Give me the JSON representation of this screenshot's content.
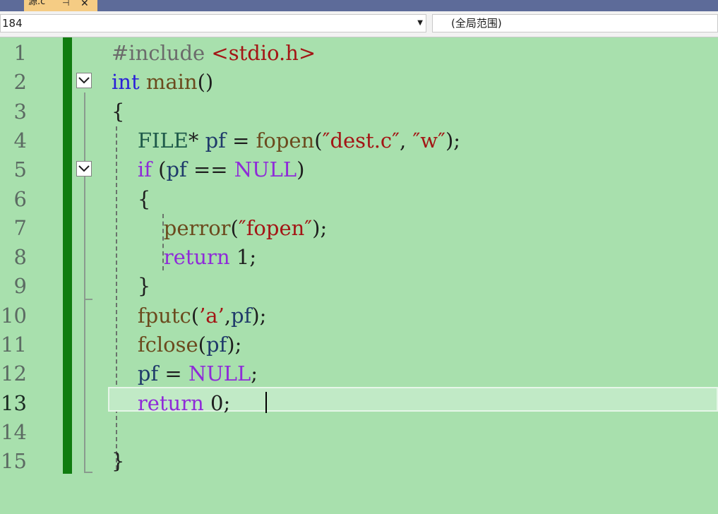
{
  "tab": {
    "title": "源.c",
    "pin_icon": "pin-icon",
    "close_icon": "close-icon"
  },
  "navbar": {
    "project": "184",
    "scope": "(全局范围)"
  },
  "editor": {
    "current_line": 13,
    "lines": [
      {
        "n": "1"
      },
      {
        "n": "2"
      },
      {
        "n": "3"
      },
      {
        "n": "4"
      },
      {
        "n": "5"
      },
      {
        "n": "6"
      },
      {
        "n": "7"
      },
      {
        "n": "8"
      },
      {
        "n": "9"
      },
      {
        "n": "10"
      },
      {
        "n": "11"
      },
      {
        "n": "12"
      },
      {
        "n": "13"
      },
      {
        "n": "14"
      },
      {
        "n": "15"
      }
    ],
    "code": [
      [
        {
          "t": "#include ",
          "c": "pp"
        },
        {
          "t": "<stdio.h>",
          "c": "str"
        }
      ],
      [
        {
          "t": "int",
          "c": "kw"
        },
        {
          "t": " ",
          "c": "op"
        },
        {
          "t": "main",
          "c": "fn"
        },
        {
          "t": "()",
          "c": "op"
        }
      ],
      [
        {
          "t": "{",
          "c": "op"
        }
      ],
      [
        {
          "t": "    ",
          "c": "op"
        },
        {
          "t": "FILE",
          "c": "type"
        },
        {
          "t": "* ",
          "c": "op"
        },
        {
          "t": "pf",
          "c": "id"
        },
        {
          "t": " = ",
          "c": "op"
        },
        {
          "t": "fopen",
          "c": "fn"
        },
        {
          "t": "(",
          "c": "op"
        },
        {
          "t": "″dest.c″",
          "c": "str"
        },
        {
          "t": ", ",
          "c": "op"
        },
        {
          "t": "″w″",
          "c": "str"
        },
        {
          "t": ");",
          "c": "op"
        }
      ],
      [
        {
          "t": "    ",
          "c": "op"
        },
        {
          "t": "if",
          "c": "kw2"
        },
        {
          "t": " (",
          "c": "op"
        },
        {
          "t": "pf",
          "c": "id"
        },
        {
          "t": " == ",
          "c": "op"
        },
        {
          "t": "NULL",
          "c": "macro"
        },
        {
          "t": ")",
          "c": "op"
        }
      ],
      [
        {
          "t": "    ",
          "c": "op"
        },
        {
          "t": "{",
          "c": "op"
        }
      ],
      [
        {
          "t": "        ",
          "c": "op"
        },
        {
          "t": "perror",
          "c": "fn"
        },
        {
          "t": "(",
          "c": "op"
        },
        {
          "t": "″fopen″",
          "c": "str"
        },
        {
          "t": ");",
          "c": "op"
        }
      ],
      [
        {
          "t": "        ",
          "c": "op"
        },
        {
          "t": "return",
          "c": "kw2"
        },
        {
          "t": " 1;",
          "c": "num"
        }
      ],
      [
        {
          "t": "    ",
          "c": "op"
        },
        {
          "t": "}",
          "c": "op"
        }
      ],
      [
        {
          "t": "    ",
          "c": "op"
        },
        {
          "t": "fputc",
          "c": "fn"
        },
        {
          "t": "(",
          "c": "op"
        },
        {
          "t": "’a’",
          "c": "str"
        },
        {
          "t": ",",
          "c": "op"
        },
        {
          "t": "pf",
          "c": "id"
        },
        {
          "t": ");",
          "c": "op"
        }
      ],
      [
        {
          "t": "    ",
          "c": "op"
        },
        {
          "t": "fclose",
          "c": "fn"
        },
        {
          "t": "(",
          "c": "op"
        },
        {
          "t": "pf",
          "c": "id"
        },
        {
          "t": ");",
          "c": "op"
        }
      ],
      [
        {
          "t": "    ",
          "c": "op"
        },
        {
          "t": "pf",
          "c": "id"
        },
        {
          "t": " = ",
          "c": "op"
        },
        {
          "t": "NULL",
          "c": "macro"
        },
        {
          "t": ";",
          "c": "op"
        }
      ],
      [
        {
          "t": "    ",
          "c": "op"
        },
        {
          "t": "return",
          "c": "kw2"
        },
        {
          "t": " 0;",
          "c": "num"
        }
      ],
      [
        {
          "t": "",
          "c": "op"
        }
      ],
      [
        {
          "t": "}",
          "c": "op"
        }
      ]
    ]
  },
  "colors": {
    "editor_bg": "#a8e0ad",
    "change_bar": "#107c10",
    "keyword": "#2b20d8",
    "control_keyword": "#8f2bd8",
    "function": "#6b4a1e",
    "string": "#a31515"
  }
}
